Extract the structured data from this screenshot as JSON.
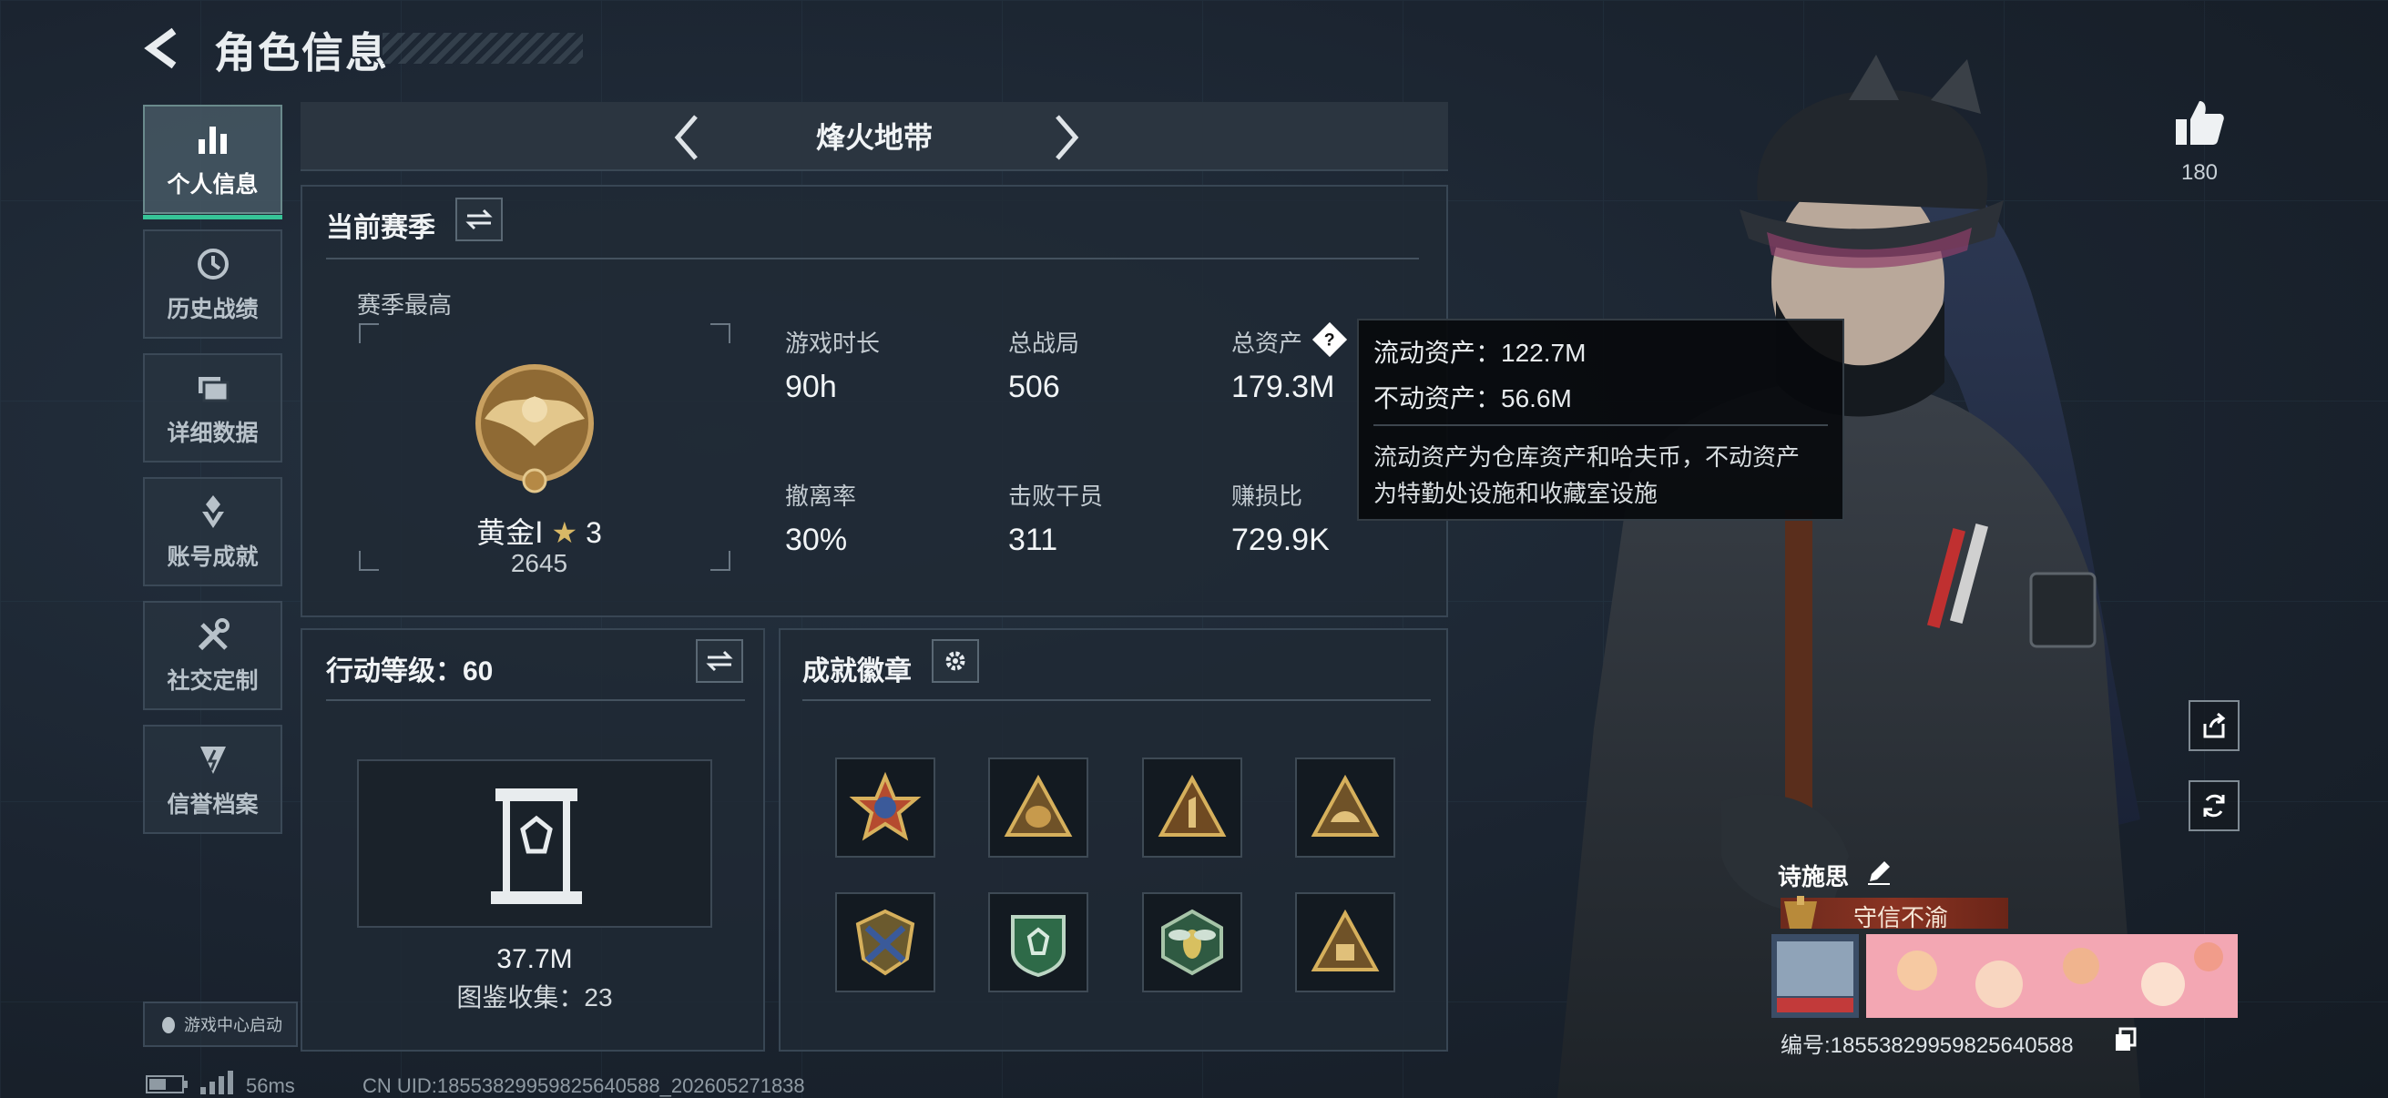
{
  "header": {
    "title": "角色信息"
  },
  "nav": {
    "items": [
      {
        "label": "个人信息",
        "icon": "bar-chart-icon",
        "active": true
      },
      {
        "label": "历史战绩",
        "icon": "history-clock-icon",
        "active": false
      },
      {
        "label": "详细数据",
        "icon": "folder-icon",
        "active": false
      },
      {
        "label": "账号成就",
        "icon": "achievement-icon",
        "active": false
      },
      {
        "label": "社交定制",
        "icon": "tools-icon",
        "active": false
      },
      {
        "label": "信誉档案",
        "icon": "reputation-icon",
        "active": false
      }
    ],
    "game_center_launch": "游戏中心启动"
  },
  "mode": {
    "title": "烽火地带"
  },
  "season": {
    "panel_title": "当前赛季",
    "best_label": "赛季最高",
    "rank_name": "黄金Ⅰ",
    "rank_stars": "3",
    "rank_score": "2645",
    "stats": [
      {
        "label": "游戏时长",
        "value": "90h"
      },
      {
        "label": "总战局",
        "value": "506"
      },
      {
        "label": "总资产",
        "value": "179.3M"
      },
      {
        "label": "撤离率",
        "value": "30%"
      },
      {
        "label": "击败干员",
        "value": "311"
      },
      {
        "label": "赚损比",
        "value": "729.9K"
      }
    ]
  },
  "tooltip": {
    "liquid": "流动资产：122.7M",
    "fixed": "不动资产：56.6M",
    "desc_line1": "流动资产为仓库资产和哈夫币，不动资产",
    "desc_line2": "为特勤处设施和收藏室设施"
  },
  "action_level": {
    "title": "行动等级：60",
    "collection_value": "37.7M",
    "collection_label": "图鉴收集：23"
  },
  "achievements": {
    "title": "成就徽章",
    "badges": [
      "star-emblem-badge",
      "money-bag-badge",
      "number-one-badge",
      "hand-triangle-badge",
      "crossed-guns-badge",
      "green-shield-badge",
      "hornet-badge",
      "fist-triangle-badge"
    ]
  },
  "profile": {
    "likes": "180",
    "name": "诗施思",
    "title_banner": "守信不渝",
    "id_label": "编号:18553829959825640588"
  },
  "footer": {
    "ping": "56ms",
    "uid": "CN UID:18553829959825640588_202605271838"
  },
  "colors": {
    "accent_green": "#36c497",
    "panel_bg": "#202a34",
    "title_banner_red": "#8a3322"
  }
}
